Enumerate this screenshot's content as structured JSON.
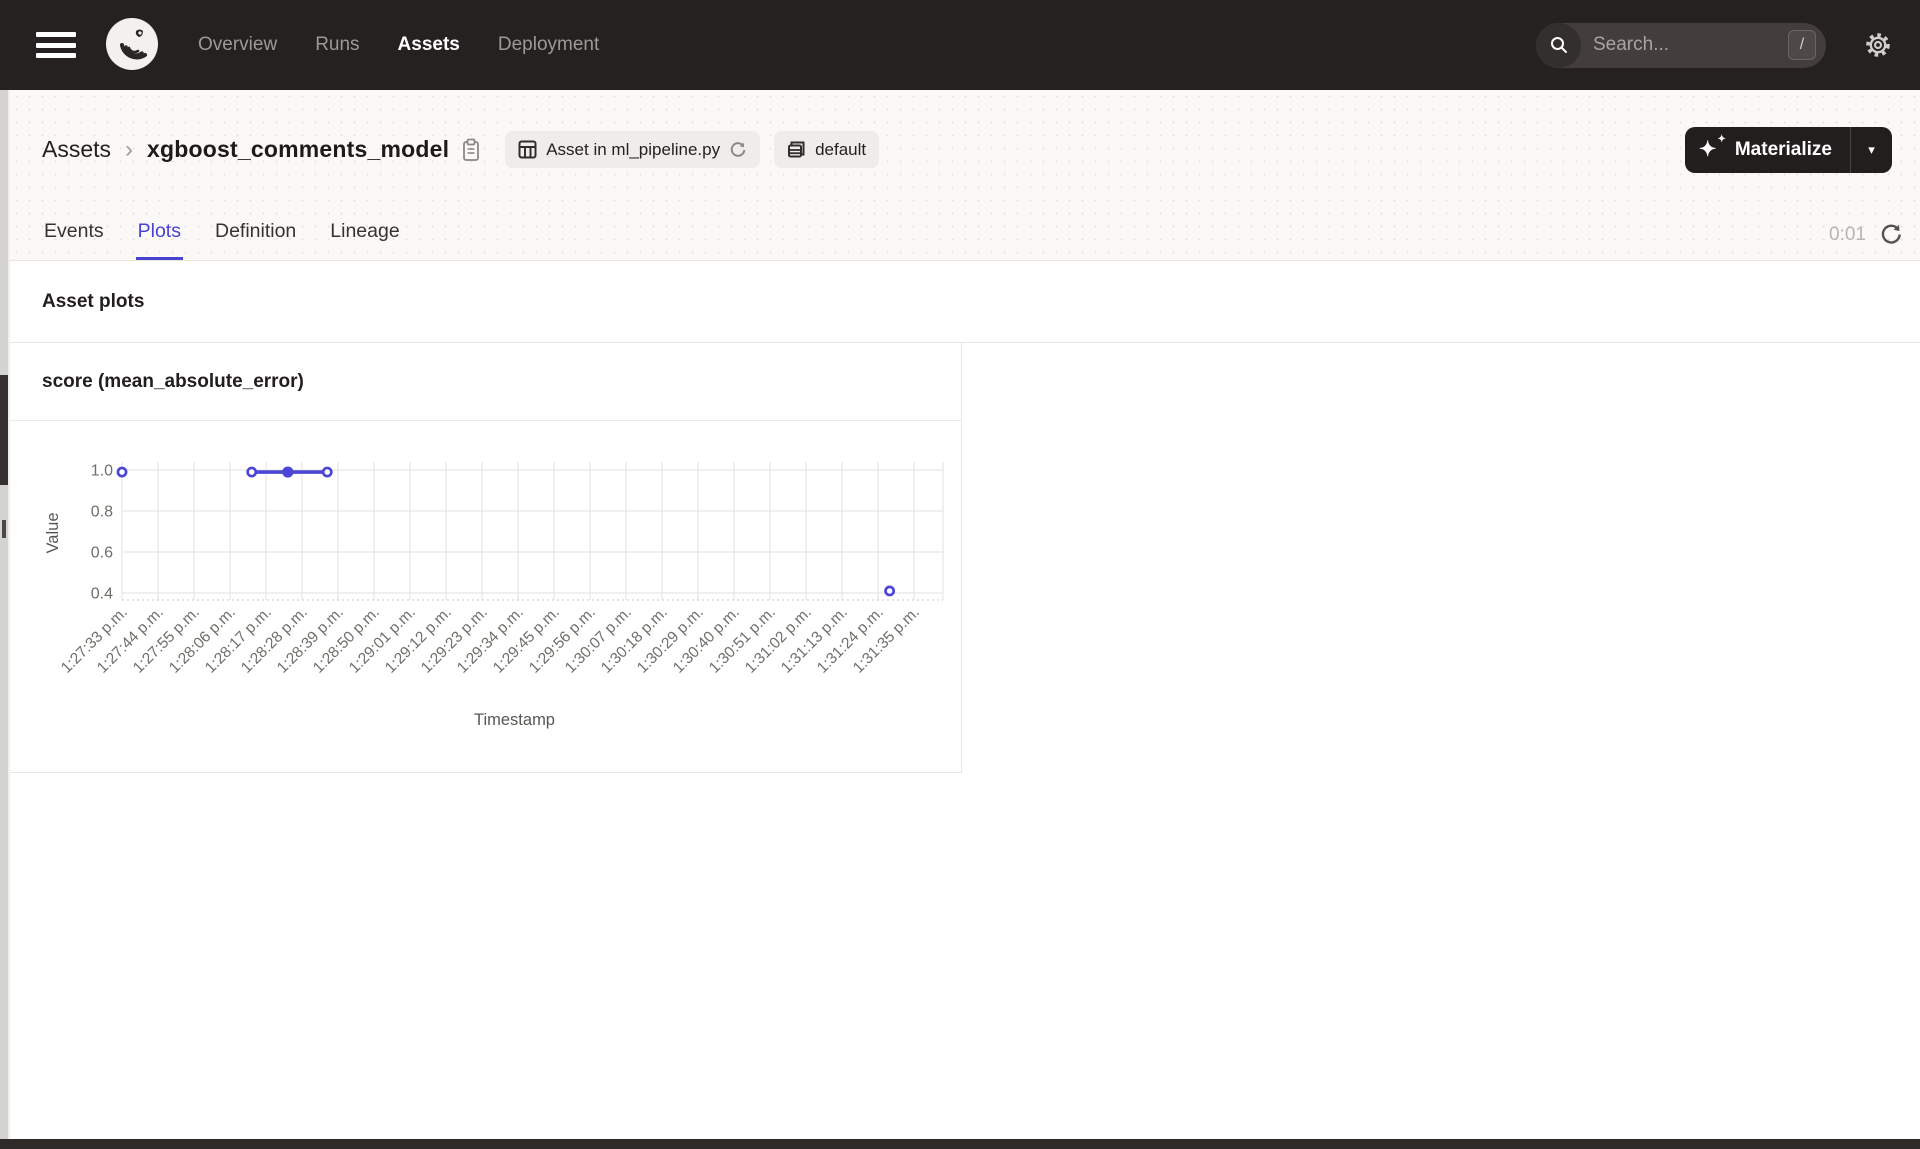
{
  "nav": {
    "items": [
      {
        "label": "Overview",
        "active": false
      },
      {
        "label": "Runs",
        "active": false
      },
      {
        "label": "Assets",
        "active": true
      },
      {
        "label": "Deployment",
        "active": false
      }
    ],
    "search": {
      "placeholder": "Search...",
      "shortcut": "/"
    }
  },
  "breadcrumb": {
    "root": "Assets",
    "separator": "›",
    "title": "xgboost_comments_model"
  },
  "chips": {
    "code_location": {
      "label": "Asset in ml_pipeline.py"
    },
    "group": {
      "label": "default"
    }
  },
  "actions": {
    "materialize_label": "Materialize"
  },
  "tabs": [
    {
      "label": "Events",
      "active": false
    },
    {
      "label": "Plots",
      "active": true
    },
    {
      "label": "Definition",
      "active": false
    },
    {
      "label": "Lineage",
      "active": false
    }
  ],
  "status": {
    "elapsed": "0:01"
  },
  "sections": {
    "asset_plots_heading": "Asset plots"
  },
  "icons": {
    "sparkle_big": "✦",
    "sparkle_small": "✦",
    "caret_down": "▾"
  },
  "colors": {
    "accent_blue": "#4a43cf",
    "chart_line": "#4b46d6",
    "grid": "#e8e6e3",
    "tick_text": "#716d68"
  },
  "chart_data": {
    "type": "line",
    "title": "score (mean_absolute_error)",
    "xlabel": "Timestamp",
    "ylabel": "Value",
    "y_ticks": [
      1.0,
      0.8,
      0.6,
      0.4
    ],
    "ylim": [
      0.37,
      1.04
    ],
    "grid": true,
    "legend": "none",
    "x_ticks": [
      "1:27:33 p.m.",
      "1:27:44 p.m.",
      "1:27:55 p.m.",
      "1:28:06 p.m.",
      "1:28:17 p.m.",
      "1:28:28 p.m.",
      "1:28:39 p.m.",
      "1:28:50 p.m.",
      "1:29:01 p.m.",
      "1:29:12 p.m.",
      "1:29:23 p.m.",
      "1:29:34 p.m.",
      "1:29:45 p.m.",
      "1:29:56 p.m.",
      "1:30:07 p.m.",
      "1:30:18 p.m.",
      "1:30:29 p.m.",
      "1:30:40 p.m.",
      "1:30:51 p.m.",
      "1:31:02 p.m.",
      "1:31:13 p.m.",
      "1:31:24 p.m.",
      "1:31:35 p.m."
    ],
    "series": [
      {
        "name": "score (mean_absolute_error)",
        "points": [
          {
            "x_frac": 0.0,
            "value": 0.99,
            "marker": "ring"
          },
          {
            "x_frac": 0.158,
            "value": 0.99,
            "marker": "ring"
          },
          {
            "x_frac": 0.202,
            "value": 0.99,
            "marker": "dot"
          },
          {
            "x_frac": 0.25,
            "value": 0.99,
            "marker": "ring"
          },
          {
            "x_frac": 0.935,
            "value": 0.41,
            "marker": "ring"
          }
        ],
        "connected_indices": [
          1,
          2,
          3
        ]
      }
    ]
  }
}
